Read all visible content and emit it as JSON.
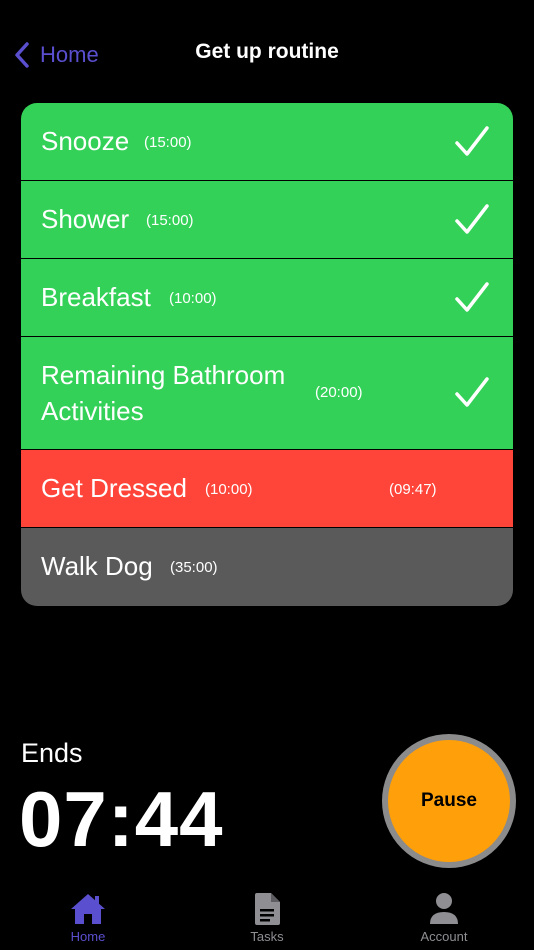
{
  "nav": {
    "back_label": "Home",
    "title": "Get up routine"
  },
  "tasks": [
    {
      "name": "Snooze",
      "duration": "(15:00)",
      "status": "done"
    },
    {
      "name": "Shower",
      "duration": "(15:00)",
      "status": "done"
    },
    {
      "name": "Breakfast",
      "duration": "(10:00)",
      "status": "done"
    },
    {
      "name": "Remaining Bathroom",
      "name_line2": "Activities",
      "duration": "(20:00)",
      "status": "done"
    },
    {
      "name": "Get Dressed",
      "duration": "(10:00)",
      "remaining": "(09:47)",
      "status": "active"
    },
    {
      "name": "Walk Dog",
      "duration": "(35:00)",
      "status": "pending"
    }
  ],
  "ends": {
    "label": "Ends",
    "time": "07:44"
  },
  "pause_label": "Pause",
  "tabs": [
    {
      "label": "Home",
      "icon": "house-icon"
    },
    {
      "label": "Tasks",
      "icon": "document-icon"
    },
    {
      "label": "Account",
      "icon": "person-icon"
    }
  ],
  "colors": {
    "accent": "#5a4fcf",
    "done": "#34d158",
    "active": "#ff453a",
    "pending": "#5a5a5a",
    "pause": "#ff9f0a",
    "tab_inactive": "#8e8e93"
  }
}
